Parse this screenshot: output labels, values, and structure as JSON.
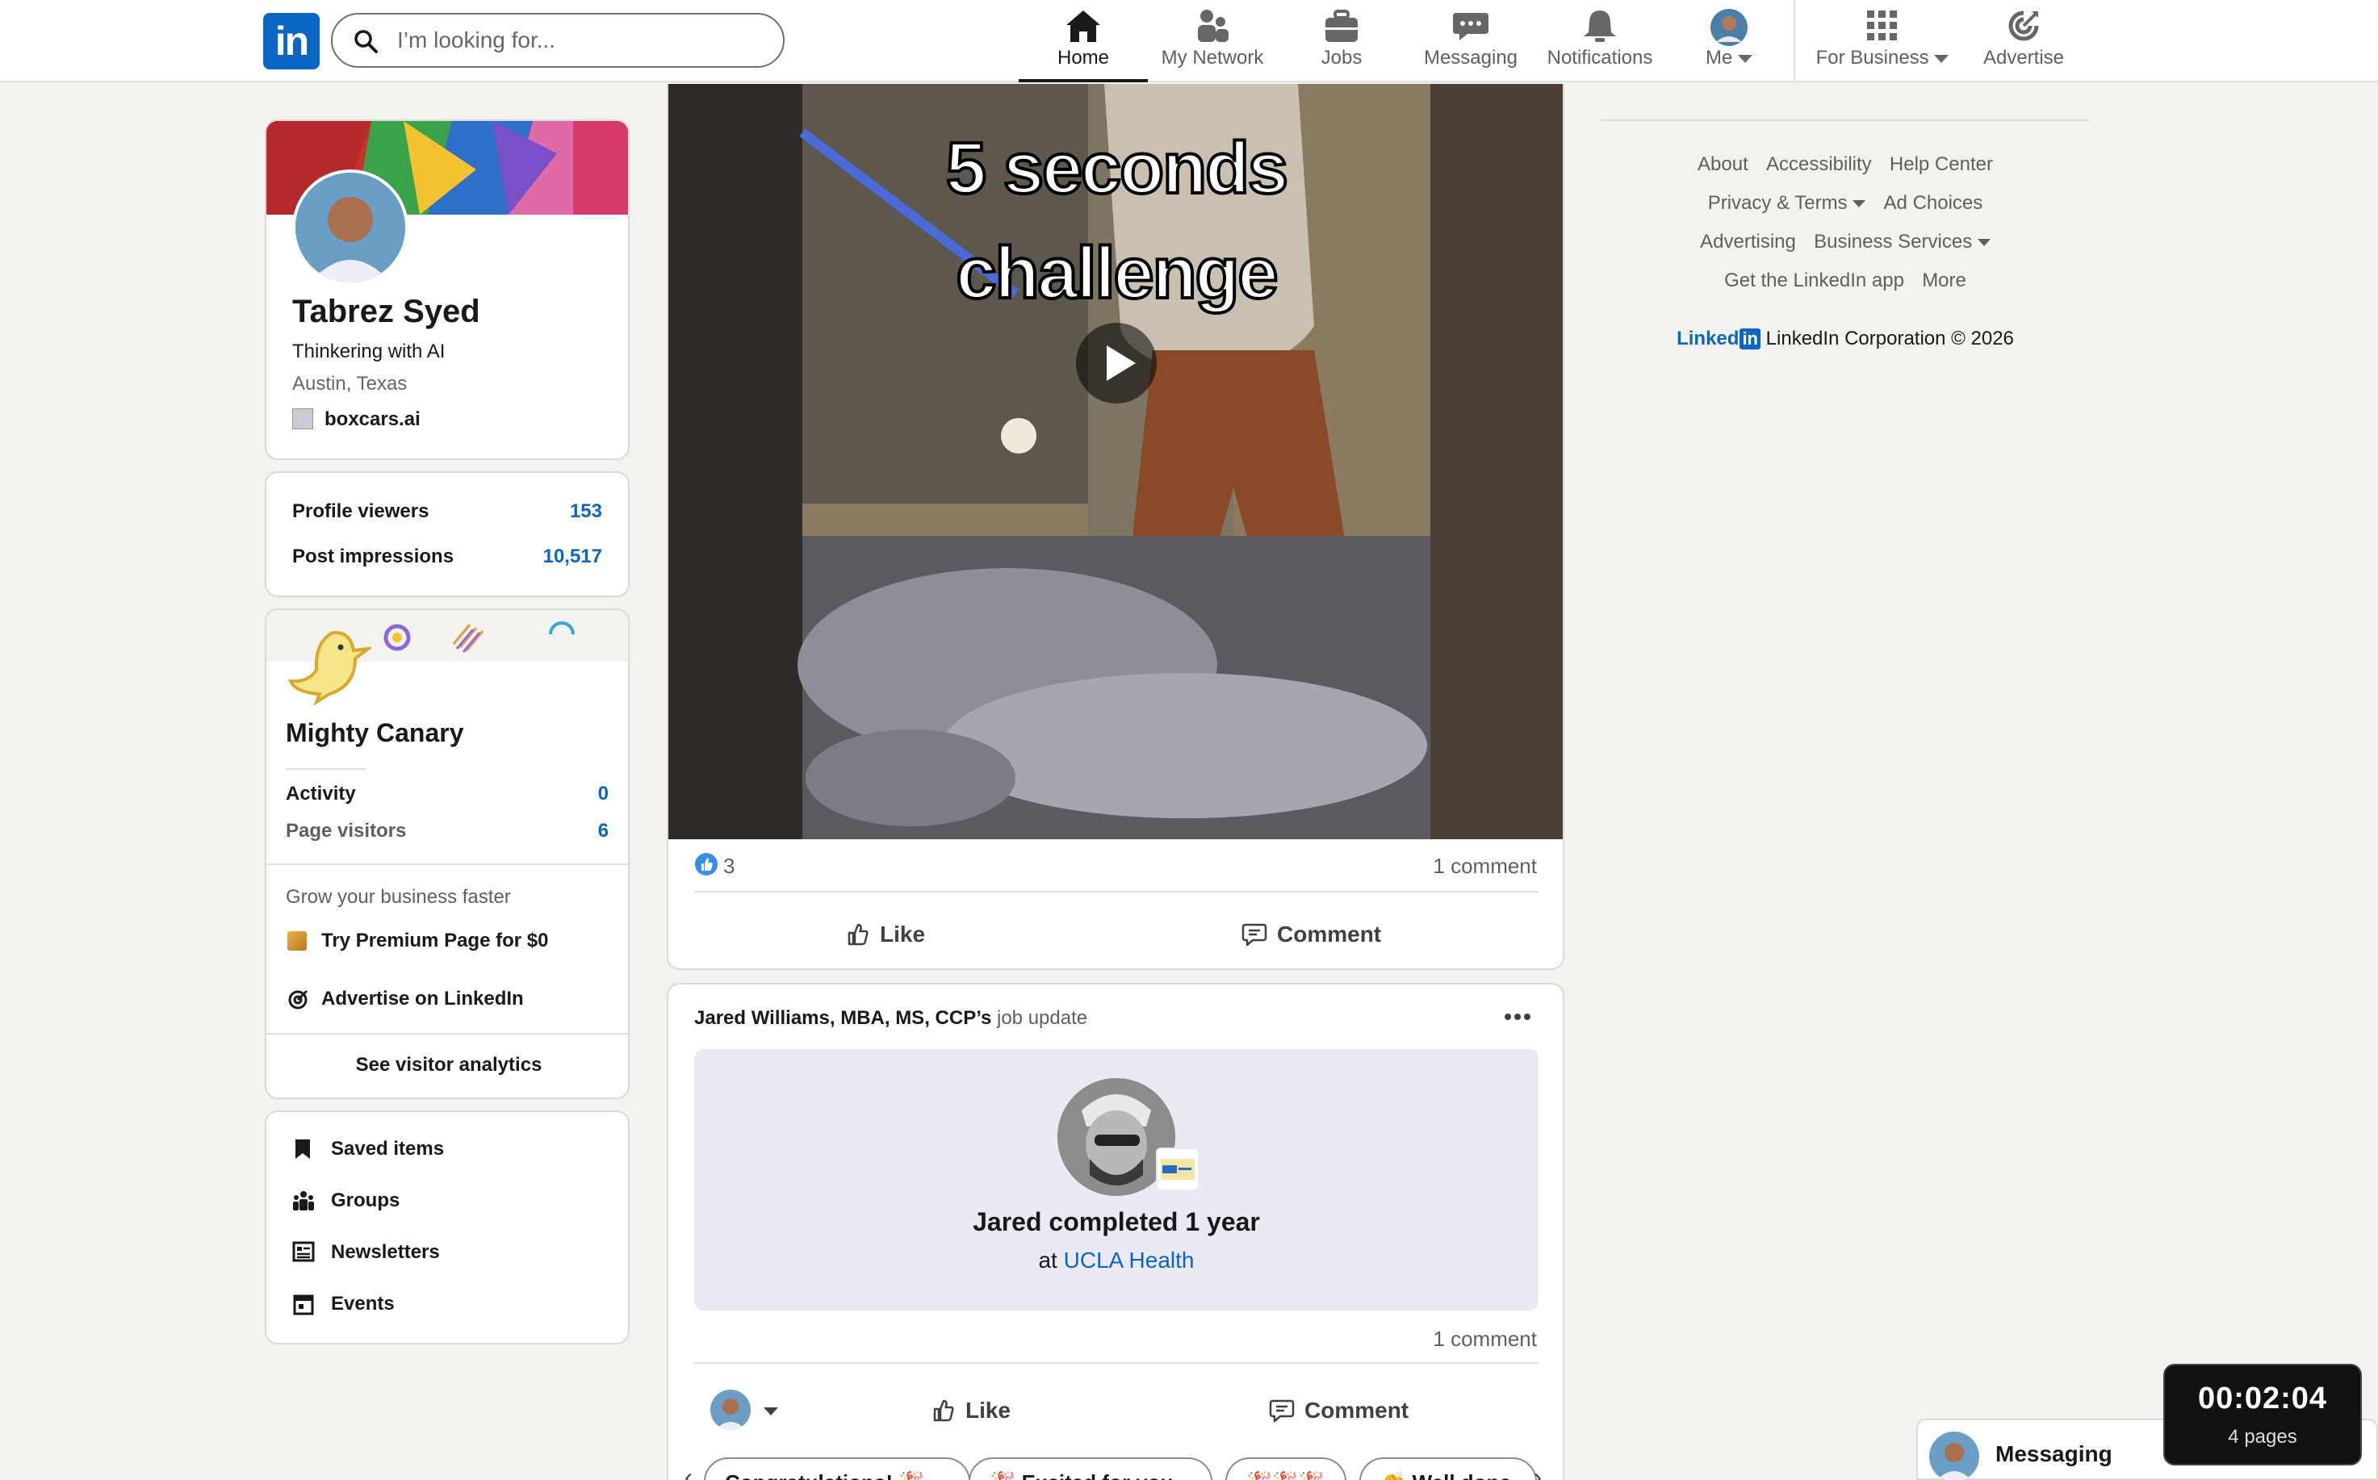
{
  "search": {
    "placeholder": "I’m looking for..."
  },
  "nav": {
    "home": "Home",
    "network": "My Network",
    "jobs": "Jobs",
    "messaging": "Messaging",
    "notifications": "Notifications",
    "me": "Me",
    "business": "For Business",
    "advertise": "Advertise"
  },
  "profile": {
    "name": "Tabrez Syed",
    "headline": "Thinkering with AI",
    "location": "Austin, Texas",
    "company": "boxcars.ai"
  },
  "stats": {
    "viewers_label": "Profile viewers",
    "viewers_value": "153",
    "impressions_label": "Post impressions",
    "impressions_value": "10,517"
  },
  "page_card": {
    "name": "Mighty Canary",
    "activity_label": "Activity",
    "activity_value": "0",
    "visitors_label": "Page visitors",
    "visitors_value": "6",
    "grow_text": "Grow your business faster",
    "premium_label": "Try Premium Page for $0",
    "advertise_label": "Advertise on LinkedIn",
    "analytics_label": "See visitor analytics"
  },
  "shortcuts": [
    "Saved items",
    "Groups",
    "Newsletters",
    "Events"
  ],
  "video_post": {
    "caption_line1": "5 seconds",
    "caption_line2": "challenge",
    "reactions_count": "3",
    "comments": "1 comment",
    "like": "Like",
    "comment": "Comment"
  },
  "job_post": {
    "author": "Jared Williams, MBA, MS, CCP’s",
    "type": "job update",
    "title": "Jared completed 1 year",
    "at": "at",
    "company": "UCLA Health",
    "comments": "1 comment",
    "like": "Like",
    "comment": "Comment",
    "chips": [
      "Congratulations! 🎉",
      "🎉 Excited for you",
      "🎉🎉🎉",
      "👏 Well done"
    ]
  },
  "footer": {
    "about": "About",
    "accessibility": "Accessibility",
    "help": "Help Center",
    "privacy": "Privacy & Terms",
    "adchoices": "Ad Choices",
    "advertising": "Advertising",
    "business_services": "Business Services",
    "app": "Get the LinkedIn app",
    "more": "More",
    "brand": "Linked",
    "copyright": "LinkedIn Corporation © 2026"
  },
  "messaging_bar": {
    "label": "Messaging"
  },
  "timer": {
    "time": "00:02:04",
    "pages": "4 pages"
  },
  "colors": {
    "brand": "#0a66c2",
    "background": "#f4f2ee"
  }
}
